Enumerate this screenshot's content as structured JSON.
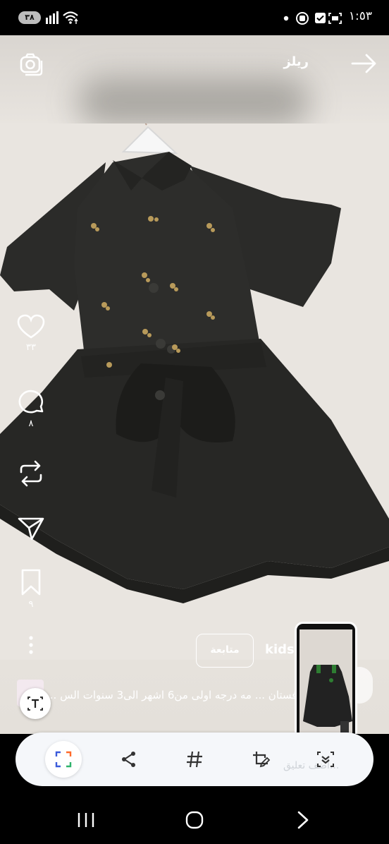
{
  "status_bar": {
    "battery": "٣٨",
    "time": "١:٥٣"
  },
  "reel": {
    "title": "ريلز",
    "username": "kids",
    "follow_label": "متابعة",
    "caption": "فستان ... مه درجه اولى  من6 اشهر الى3 سنوات الس ...",
    "actions": [
      {
        "name": "like",
        "icon": "heart-icon",
        "count": "٣٣"
      },
      {
        "name": "comment",
        "icon": "comment-icon",
        "count": "٨"
      },
      {
        "name": "repost",
        "icon": "repost-icon",
        "count": ""
      },
      {
        "name": "share",
        "icon": "send-icon",
        "count": ""
      },
      {
        "name": "save",
        "icon": "bookmark-icon",
        "count": "٩"
      },
      {
        "name": "more",
        "icon": "more-vertical-icon",
        "count": ""
      }
    ]
  },
  "toolbar": {
    "comment_placeholder": "أضف تعليق...",
    "tools": [
      {
        "name": "scan",
        "icon": "scan-frame-icon",
        "active": true
      },
      {
        "name": "share",
        "icon": "share-icon"
      },
      {
        "name": "hashtag",
        "icon": "hashtag-icon"
      },
      {
        "name": "edit-crop",
        "icon": "crop-edit-icon"
      },
      {
        "name": "expand",
        "icon": "expand-scan-icon"
      }
    ]
  },
  "nav": {
    "items": [
      "recent-apps-icon",
      "home-icon",
      "back-icon"
    ]
  }
}
